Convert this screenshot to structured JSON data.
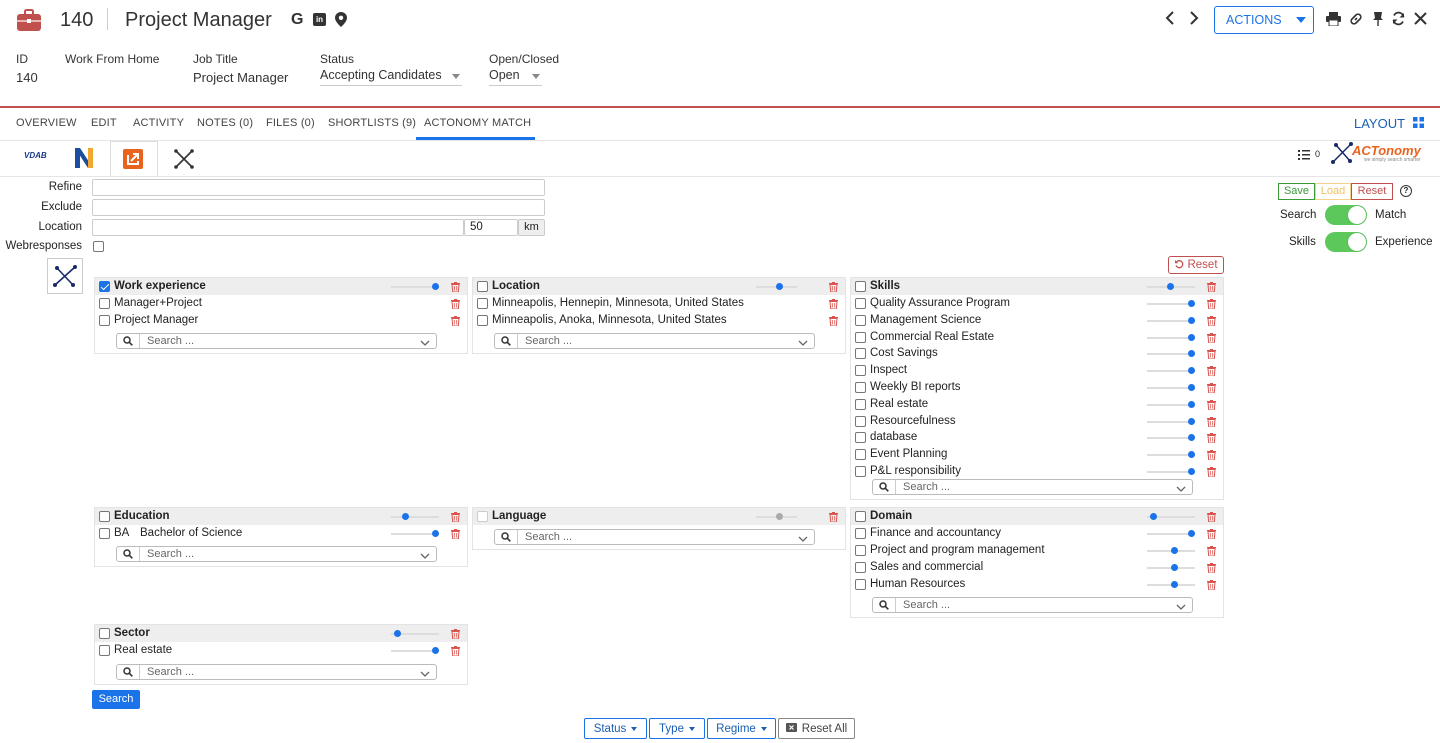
{
  "header": {
    "record_id": "140",
    "title": "Project Manager",
    "actions_label": "ACTIONS"
  },
  "summary": {
    "id": {
      "label": "ID",
      "value": "140"
    },
    "wfh": {
      "label": "Work From Home",
      "value": ""
    },
    "job_title": {
      "label": "Job Title",
      "value": "Project Manager"
    },
    "status": {
      "label": "Status",
      "value": "Accepting Candidates"
    },
    "open_closed": {
      "label": "Open/Closed",
      "value": "Open"
    }
  },
  "tabs": [
    "OVERVIEW",
    "EDIT",
    "ACTIVITY",
    "NOTES (0)",
    "FILES (0)",
    "SHORTLISTS (9)",
    "ACTONOMY MATCH"
  ],
  "layout_label": "LAYOUT",
  "subtabs": {
    "vdab": "VDAB",
    "count": "0",
    "logo": "ACTonomy",
    "logo_tagline": "we simply search smarter"
  },
  "form": {
    "refine_label": "Refine",
    "exclude_label": "Exclude",
    "location_label": "Location",
    "radius": "50",
    "unit": "km",
    "webresponses_label": "Webresponses"
  },
  "controls": {
    "save": "Save",
    "load": "Load",
    "reset": "Reset",
    "search_label": "Search",
    "match_label": "Match",
    "skills_label": "Skills",
    "experience_label": "Experience",
    "reset_panels": "Reset"
  },
  "panels": {
    "work_experience": {
      "title": "Work experience",
      "items": [
        "Manager+Project",
        "Project Manager"
      ]
    },
    "location": {
      "title": "Location",
      "items": [
        "Minneapolis, Hennepin, Minnesota, United States",
        "Minneapolis, Anoka, Minnesota, United States"
      ]
    },
    "skills": {
      "title": "Skills",
      "items": [
        "Quality Assurance Program",
        "Management Science",
        "Commercial Real Estate",
        "Cost Savings",
        "Inspect",
        "Weekly BI reports",
        "Real estate",
        "Resourcefulness",
        "database",
        "Event Planning",
        "P&L responsibility"
      ]
    },
    "education": {
      "title": "Education",
      "item_code": "BA",
      "item_label": "Bachelor of Science"
    },
    "language": {
      "title": "Language"
    },
    "domain": {
      "title": "Domain",
      "items": [
        "Finance and accountancy",
        "Project and program management",
        "Sales and commercial",
        "Human Resources"
      ]
    },
    "sector": {
      "title": "Sector",
      "items": [
        "Real estate"
      ]
    }
  },
  "search_placeholder": "Search ...",
  "search_button": "Search",
  "footer": {
    "status": "Status",
    "type": "Type",
    "regime": "Regime",
    "reset_all": "Reset All"
  },
  "colors": {
    "accent": "#1a73e8",
    "brand_red": "#c0504d",
    "toggle_green": "#5cc85c"
  }
}
